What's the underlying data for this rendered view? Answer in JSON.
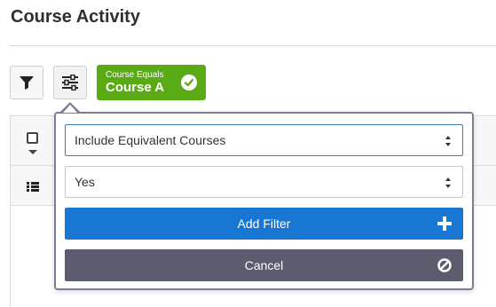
{
  "header": {
    "title": "Course Activity"
  },
  "toolbar": {
    "filter_icon": "filter-icon",
    "settings_icon": "sliders-icon"
  },
  "active_filter": {
    "caption": "Course Equals",
    "value": "Course A",
    "status_icon": "check-circle-icon",
    "color": "#5aaa16"
  },
  "popover": {
    "option_select": {
      "value": "Include Equivalent Courses"
    },
    "value_select": {
      "value": "Yes"
    },
    "add_button": {
      "label": "Add Filter",
      "icon": "plus-icon",
      "color": "#1777d2"
    },
    "cancel_button": {
      "label": "Cancel",
      "icon": "ban-icon",
      "color": "#5b5d6e"
    }
  },
  "table": {
    "select_icon": "checkbox-icon",
    "row_icon": "list-icon"
  }
}
